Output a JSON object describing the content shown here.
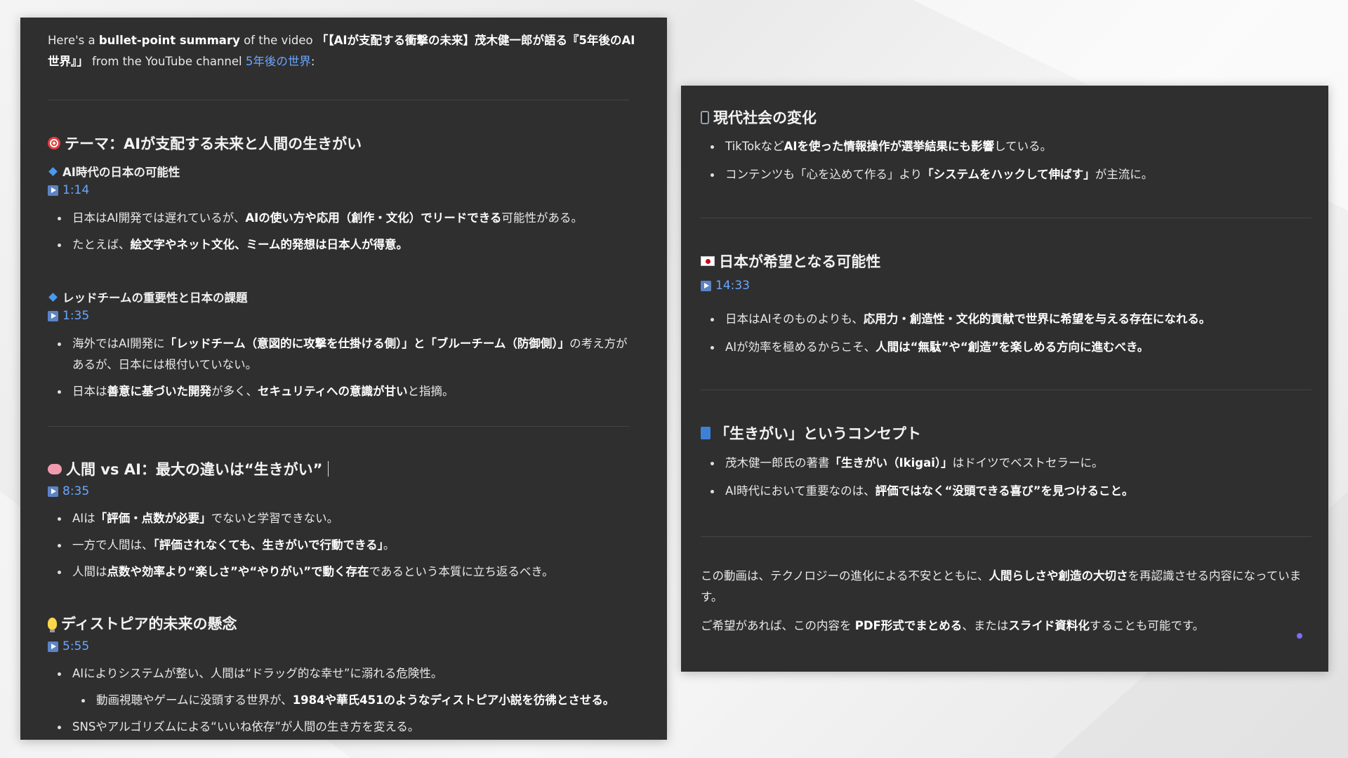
{
  "left": {
    "intro": {
      "p1": "Here's a ",
      "b1": "bullet-point summary",
      "p2": " of the video ",
      "b2": "「【AIが支配する衝撃の未来】茂木健一郎が語る『5年後のAI世界』」",
      "p3": " from the YouTube channel ",
      "channel": "5年後の世界",
      "p4": ":"
    },
    "theme": {
      "title": "テーマ：AIが支配する未来と人間の生きがい",
      "sub1": {
        "title": "AI時代の日本の可能性",
        "ts": "1:14",
        "b1": [
          "日本はAI開発では遅れているが、",
          "AIの使い方や応用（創作・文化）でリードできる",
          "可能性がある。"
        ],
        "b2": [
          "たとえば、",
          "絵文字やネット文化、ミーム的発想は日本人が得意。"
        ]
      },
      "sub2": {
        "title": "レッドチームの重要性と日本の課題",
        "ts": "1:35",
        "b1": [
          "海外ではAI開発に",
          "「レッドチーム（意図的に攻撃を仕掛ける側）」と「ブルーチーム（防御側）」",
          "の考え方があるが、日本には根付いていない。"
        ],
        "b2": [
          "日本は",
          "善意に基づいた開発",
          "が多く、",
          "セキュリティへの意識が甘い",
          "と指摘。"
        ]
      }
    },
    "human": {
      "title": "人間 vs AI：最大の違いは“生きがい”",
      "ts": "8:35",
      "b1": [
        "AIは",
        "「評価・点数が必要」",
        "でないと学習できない。"
      ],
      "b2": [
        "一方で人間は、",
        "「評価されなくても、生きがいで行動できる」",
        "。"
      ],
      "b3": [
        "人間は",
        "点数や効率より“楽しさ”や“やりがい”で動く存在",
        "であるという本質に立ち返るべき。"
      ]
    },
    "dystopia": {
      "title": "ディストピア的未来の懸念",
      "ts": "5:55",
      "b1": "AIによりシステムが整い、人間は“ドラッグ的な幸せ”に溺れる危険性。",
      "b1a": [
        "動画視聴やゲームに没頭する世界が、",
        "1984や華氏451のようなディストピア小説を彷彿とさせる。"
      ],
      "b2": "SNSやアルゴリズムによる“いいね依存”が人間の生き方を変える。"
    }
  },
  "right": {
    "modern": {
      "title": "現代社会の変化",
      "b1": [
        "TikTokなど",
        "AIを使った情報操作が選挙結果にも影響",
        "している。"
      ],
      "b2": [
        "コンテンツも「心を込めて作る」より",
        "「システムをハックして伸ばす」",
        "が主流に。"
      ]
    },
    "japan": {
      "title": "日本が希望となる可能性",
      "ts": "14:33",
      "b1": [
        "日本はAIそのものよりも、",
        "応用力・創造性・文化的貢献で世界に希望を与える存在になれる。"
      ],
      "b2": [
        "AIが効率を極めるからこそ、",
        "人間は“無駄”や“創造”を楽しめる方向に進むべき。"
      ]
    },
    "ikigai": {
      "title": "「生きがい」というコンセプト",
      "b1": [
        "茂木健一郎氏の著書",
        "「生きがい（Ikigai）」",
        "はドイツでベストセラーに。"
      ],
      "b2": [
        "AI時代において重要なのは、",
        "評価ではなく“没頭できる喜び”を見つけること。"
      ]
    },
    "closing": {
      "p1a": "この動画は、テクノロジーの進化による不安とともに、",
      "p1b": "人間らしさや創造の大切さ",
      "p1c": "を再認識させる内容になっています。",
      "p2a": "ご希望があれば、この内容を ",
      "p2b": "PDF形式でまとめる",
      "p2c": "、または",
      "p2d": "スライド資料化",
      "p2e": "することも可能です。"
    }
  }
}
